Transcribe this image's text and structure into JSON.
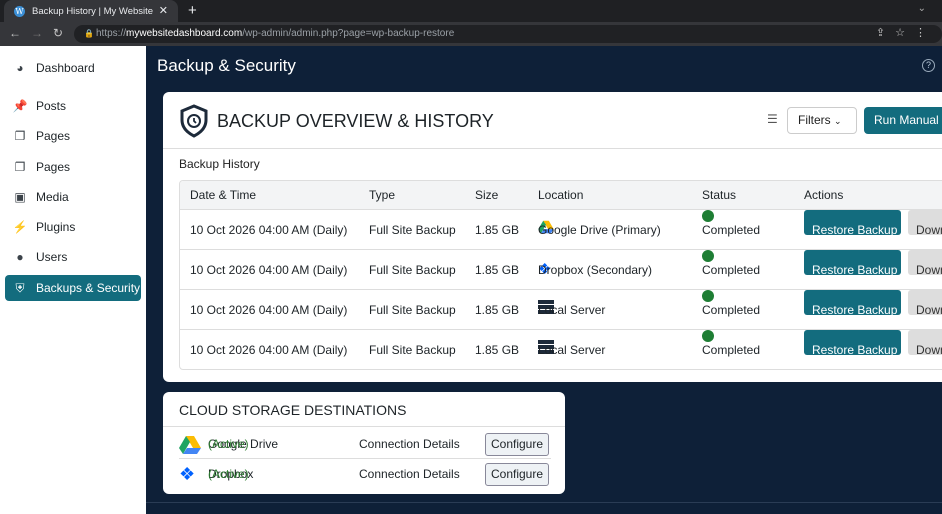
{
  "browser": {
    "tab_title": "Backup History | My Website",
    "url_prefix": "https://",
    "url_domain": "mywebsitedashboard.com",
    "url_path": "/wp-admin/admin.php?page=wp-backup-restore"
  },
  "sidebar": {
    "items": [
      {
        "label": "Dashboard",
        "icon": "dashboard-icon"
      },
      {
        "label": "Posts",
        "icon": "pin-icon"
      },
      {
        "label": "Pages",
        "icon": "pages-icon"
      },
      {
        "label": "Pages",
        "icon": "pages-icon"
      },
      {
        "label": "Media",
        "icon": "media-icon"
      },
      {
        "label": "Plugins",
        "icon": "plugin-icon"
      },
      {
        "label": "Users",
        "icon": "user-icon"
      },
      {
        "label": "Backups & Security",
        "icon": "shield-icon",
        "active": true
      }
    ]
  },
  "page_title": "Backup & Security",
  "overview": {
    "title": "BACKUP OVERVIEW & HISTORY",
    "filters_label": "Filters",
    "run_label": "Run Manual Backup",
    "section_label": "Backup History",
    "columns": [
      "Date & Time",
      "Type",
      "Size",
      "Location",
      "Status",
      "Actions"
    ],
    "rows": [
      {
        "date": "10 Oct 2026 04:00 AM (Daily)",
        "type": "Full Site Backup",
        "size": "1.85 GB",
        "location": "Google Drive (Primary)",
        "status": "Completed",
        "restore": "Restore Backup",
        "download": "Download"
      },
      {
        "date": "10 Oct 2026 04:00 AM (Daily)",
        "type": "Full Site Backup",
        "size": "1.85 GB",
        "location": "Dropbox (Secondary)",
        "status": "Completed",
        "restore": "Restore Backup",
        "download": "Download"
      },
      {
        "date": "10 Oct 2026 04:00 AM (Daily)",
        "type": "Full Site Backup",
        "size": "1.85 GB",
        "location": "Local Server",
        "status": "Completed",
        "restore": "Restore Backup",
        "download": "Download"
      },
      {
        "date": "10 Oct 2026 04:00 AM (Daily)",
        "type": "Full Site Backup",
        "size": "1.85 GB",
        "location": "Local Server",
        "status": "Completed",
        "restore": "Restore Backup",
        "download": "Download"
      }
    ]
  },
  "cloud": {
    "title": "CLOUD STORAGE DESTINATIONS",
    "items": [
      {
        "name": "Google Drive",
        "state": "(Active)",
        "details": "Connection Details",
        "button": "Configure"
      },
      {
        "name": "Dropbox",
        "state": "(Active)",
        "details": "Connection Details",
        "button": "Configure"
      }
    ]
  },
  "colors": {
    "accent": "#136c7e",
    "background": "#0e2038",
    "success": "#1e7e34"
  }
}
